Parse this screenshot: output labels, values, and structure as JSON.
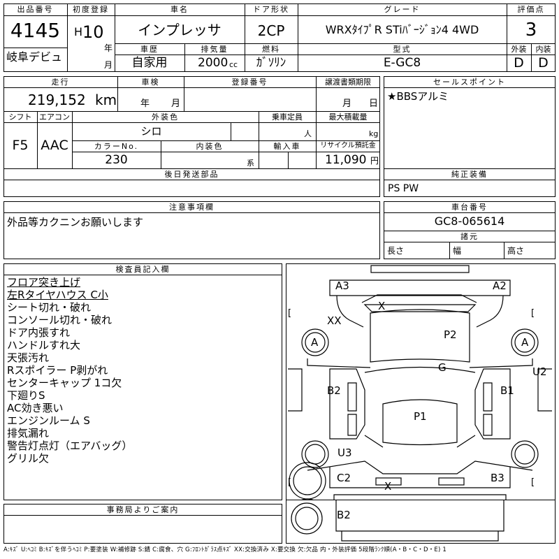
{
  "header": {
    "lot_label": "出品番号",
    "lot": "4145",
    "reg_label": "初度登録",
    "era": "H",
    "year": "10",
    "year_unit": "年",
    "month_unit": "月",
    "name_label": "車名",
    "name": "インプレッサ",
    "door_label": "ドア形状",
    "door": "2CP",
    "grade_label": "グレード",
    "grade": "WRXﾀｲﾌﾟR STiﾊﾞｰｼﾞｮﾝ4 4WD",
    "score_label": "評価点",
    "score": "3",
    "debut": "岐阜デビュ",
    "history_label": "車歴",
    "history": "自家用",
    "disp_label": "排気量",
    "disp": "2000",
    "disp_unit": "cc",
    "fuel_label": "燃料",
    "fuel": "ｶﾞｿﾘﾝ",
    "model_label": "型式",
    "model": "E-GC8",
    "ext_label": "外装",
    "ext": "D",
    "int_label": "内装",
    "int": "D"
  },
  "mid": {
    "mileage_label": "走行",
    "mileage": "219,152",
    "km": "km",
    "inspection_label": "車検",
    "year_unit": "年",
    "month_unit": "月",
    "regno_label": "登録番号",
    "transfer_label": "譲渡書類期限",
    "t_month": "月",
    "t_day": "日",
    "shift_label": "シフト",
    "shift": "F5",
    "ac_label": "エアコン",
    "ac": "AAC",
    "color_label": "外装色",
    "color": "シロ",
    "cap_label": "乗車定員",
    "cap_unit": "人",
    "load_label": "最大積載量",
    "load_unit": "kg",
    "colorno_label": "カラーNo.",
    "colorno": "230",
    "intcolor_label": "内装色",
    "intcolor_unit": "系",
    "import_label": "輸入車",
    "recycle_label": "リサイクル預託金",
    "recycle": "11,090",
    "recycle_unit": "円",
    "later_label": "後日発送部品"
  },
  "sales": {
    "label": "セールスポイント",
    "text": "★BBSアルミ"
  },
  "equip": {
    "label": "純正装備",
    "text": "PS PW"
  },
  "notes": {
    "label": "注意事項欄",
    "text": "外品等カクニンお願いします"
  },
  "chassis": {
    "label": "車台番号",
    "number": "GC8-065614",
    "dims_label": "諸元",
    "length": "長さ",
    "width": "幅",
    "height": "高さ"
  },
  "inspector": {
    "label": "検査員記入欄",
    "items": [
      "フロア突き上げ",
      "左Rタイヤハウス C小",
      "シート切れ・破れ",
      "コンソール切れ・破れ",
      "ドア内張すれ",
      "ハンドルすれ大",
      "天張汚れ",
      "Rスポイラー P剥がれ",
      "センターキャップ 1コ欠",
      "下廻りS",
      "AC効き悪い",
      "エンジンルーム S",
      "排気漏れ",
      "警告灯点灯（エアバッグ）",
      "グリル欠"
    ]
  },
  "office": {
    "label": "事務局よりご案内"
  },
  "map_marks": {
    "a3": "A3",
    "a2": "A2",
    "x_top": "X",
    "xx": "XX",
    "p2": "P2",
    "a_left": "A",
    "a_right": "A",
    "g": "G",
    "u2": "U2",
    "b2_left": "B2",
    "b1": "B1",
    "p1": "P1",
    "u3": "U3",
    "c2": "C2",
    "x_rear": "X",
    "b3": "B3",
    "b2_bottom": "B2",
    "br": "["
  },
  "legend": "A:ｷｽﾞ U:ﾍｺﾐ B:ｷｽﾞを伴うﾍｺﾐ P:要塗装 W:補修跡 S:錆 C:腐食、穴 G:ﾌﾛﾝﾄｶﾞﾗｽ点ｷｽﾞ XX:交換済み X:要交換 欠:欠品 内・外装評価 5段階ﾗﾝｸ順(A・B・C・D・E) 1"
}
